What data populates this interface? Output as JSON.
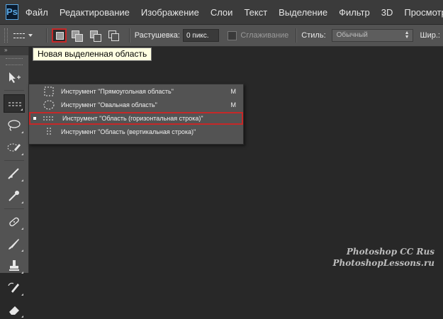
{
  "menubar": {
    "logo": "Ps",
    "items": [
      "Файл",
      "Редактирование",
      "Изображение",
      "Слои",
      "Текст",
      "Выделение",
      "Фильтр",
      "3D",
      "Просмотр"
    ]
  },
  "options_bar": {
    "feather_label": "Растушевка:",
    "feather_value": "0 пикс.",
    "antialias_label": "Сглаживание",
    "style_label": "Стиль:",
    "style_value": "Обычный",
    "width_label": "Шир.:"
  },
  "tooltip": {
    "text": "Новая выделенная область"
  },
  "toolbar": {
    "expand_label": "»"
  },
  "flyout": {
    "items": [
      {
        "label": "Инструмент \"Прямоугольная область\"",
        "key": "M",
        "icon": "rect-marquee-icon"
      },
      {
        "label": "Инструмент \"Овальная область\"",
        "key": "M",
        "icon": "ellipse-marquee-icon"
      },
      {
        "label": "Инструмент \"Область (горизонтальная строка)\"",
        "key": "",
        "icon": "single-row-marquee-icon"
      },
      {
        "label": "Инструмент \"Область (вертикальная строка)\"",
        "key": "",
        "icon": "single-column-marquee-icon"
      }
    ]
  },
  "watermark": {
    "line1": "Photoshop CC Rus",
    "line2": "PhotoshopLessons.ru"
  },
  "colors": {
    "highlight": "#c62828",
    "tooltip_bg": "#ffffe1",
    "logo": "#5aa9e6"
  }
}
